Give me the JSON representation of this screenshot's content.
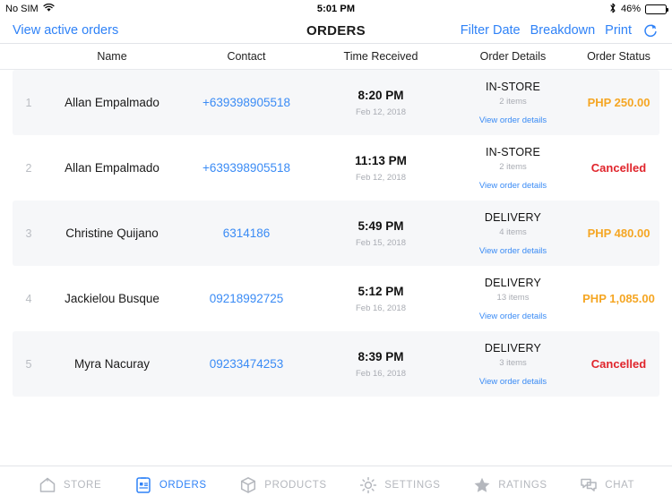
{
  "status_bar": {
    "carrier": "No SIM",
    "wifi_icon": "wifi-icon",
    "time": "5:01 PM",
    "bluetooth_icon": "bluetooth-icon",
    "battery_percent": "46%",
    "battery_level": 46
  },
  "nav_bar": {
    "left_link": "View active orders",
    "title": "ORDERS",
    "filter_date": "Filter Date",
    "breakdown": "Breakdown",
    "print": "Print",
    "refresh_icon": "refresh-icon"
  },
  "table": {
    "columns": [
      "Name",
      "Contact",
      "Time Received",
      "Order Details",
      "Order Status"
    ],
    "view_details_label": "View order details",
    "rows": [
      {
        "index": "1",
        "name": "Allan Empalmado",
        "contact": "+639398905518",
        "time": "8:20 PM",
        "date": "Feb 12, 2018",
        "order_type": "IN-STORE",
        "items": "2 items",
        "status": "PHP 250.00",
        "status_color": "#f5a623"
      },
      {
        "index": "2",
        "name": "Allan Empalmado",
        "contact": "+639398905518",
        "time": "11:13 PM",
        "date": "Feb 12, 2018",
        "order_type": "IN-STORE",
        "items": "2 items",
        "status": "Cancelled",
        "status_color": "#e0242b"
      },
      {
        "index": "3",
        "name": "Christine Quijano",
        "contact": "6314186",
        "time": "5:49 PM",
        "date": "Feb 15, 2018",
        "order_type": "DELIVERY",
        "items": "4 items",
        "status": "PHP 480.00",
        "status_color": "#f5a623"
      },
      {
        "index": "4",
        "name": "Jackielou Busque",
        "contact": "09218992725",
        "time": "5:12 PM",
        "date": "Feb 16, 2018",
        "order_type": "DELIVERY",
        "items": "13 items",
        "status": "PHP 1,085.00",
        "status_color": "#f5a623"
      },
      {
        "index": "5",
        "name": "Myra Nacuray",
        "contact": "09233474253",
        "time": "8:39 PM",
        "date": "Feb 16, 2018",
        "order_type": "DELIVERY",
        "items": "3 items",
        "status": "Cancelled",
        "status_color": "#e0242b"
      }
    ]
  },
  "tab_bar": {
    "active_color": "#2f82f7",
    "inactive_color": "#b4b7bd",
    "tabs": [
      {
        "label": "STORE",
        "icon": "home-icon",
        "active": false
      },
      {
        "label": "ORDERS",
        "icon": "list-icon",
        "active": true
      },
      {
        "label": "PRODUCTS",
        "icon": "box-icon",
        "active": false
      },
      {
        "label": "SETTINGS",
        "icon": "gear-icon",
        "active": false
      },
      {
        "label": "RATINGS",
        "icon": "star-icon",
        "active": false
      },
      {
        "label": "CHAT",
        "icon": "chat-icon",
        "active": false
      }
    ]
  }
}
